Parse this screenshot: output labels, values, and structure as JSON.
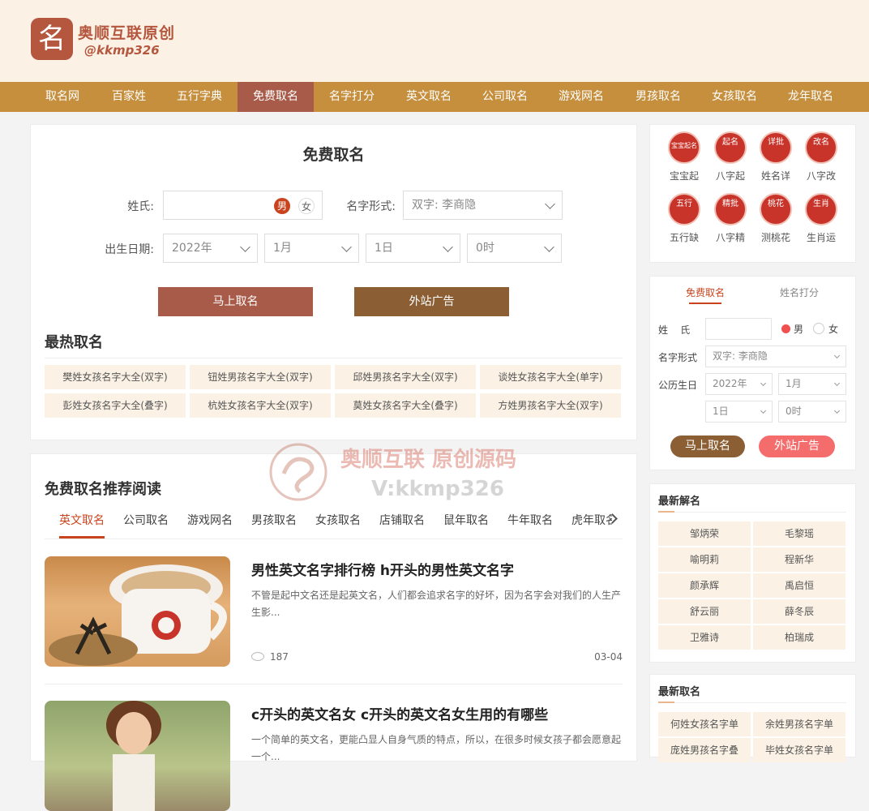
{
  "logo": {
    "mark": "名",
    "line1": "奥顺互联原创",
    "line2": "@kkmp326"
  },
  "nav": [
    "取名网",
    "百家姓",
    "五行字典",
    "免费取名",
    "名字打分",
    "英文取名",
    "公司取名",
    "游戏网名",
    "男孩取名",
    "女孩取名",
    "龙年取名"
  ],
  "nav_active": "免费取名",
  "form": {
    "title": "免费取名",
    "surname_label": "姓氏:",
    "male": "男",
    "female": "女",
    "style_label": "名字形式:",
    "style_value": "双字: 李商隐",
    "birth_label": "出生日期:",
    "year": "2022年",
    "month": "1月",
    "day": "1日",
    "hour": "0时",
    "btn_submit": "马上取名",
    "btn_ad": "外站广告"
  },
  "hot": {
    "title": "最热取名",
    "items": [
      "樊姓女孩名字大全(双字)",
      "钮姓男孩名字大全(双字)",
      "邱姓男孩名字大全(双字)",
      "谈姓女孩名字大全(单字)",
      "彭姓女孩名字大全(叠字)",
      "杭姓女孩名字大全(双字)",
      "莫姓女孩名字大全(叠字)",
      "方姓男孩名字大全(双字)"
    ]
  },
  "reading": {
    "title": "免费取名推荐阅读",
    "tabs": [
      "英文取名",
      "公司取名",
      "游戏网名",
      "男孩取名",
      "女孩取名",
      "店铺取名",
      "鼠年取名",
      "牛年取名",
      "虎年取名"
    ],
    "articles": [
      {
        "title": "男性英文名字排行榜 h开头的男性英文名字",
        "desc": "不管是起中文名还是起英文名，人们都会追求名字的好坏，因为名字会对我们的人生产生影...",
        "views": "187",
        "date": "03-04"
      },
      {
        "title": "c开头的英文名女 c开头的英文名女生用的有哪些",
        "desc": "一个简单的英文名，更能凸显人自身气质的特点，所以，在很多时候女孩子都会愿意起一个..."
      }
    ]
  },
  "watermark": {
    "line1": "奥顺互联 原创源码",
    "line2": "V:kkmp326"
  },
  "side_icons": [
    {
      "top": "宝宝起名",
      "label": "宝宝起"
    },
    {
      "top": "起名",
      "label": "八字起"
    },
    {
      "top": "详批",
      "label": "姓名详"
    },
    {
      "top": "改名",
      "label": "八字改"
    },
    {
      "top": "五行",
      "label": "五行缺"
    },
    {
      "top": "精批",
      "label": "八字精"
    },
    {
      "top": "桃花",
      "label": "测桃花"
    },
    {
      "top": "生肖",
      "label": "生肖运"
    }
  ],
  "side_form": {
    "tab1": "免费取名",
    "tab2": "姓名打分",
    "surname_label": "姓    氏",
    "male": "男",
    "female": "女",
    "style_label": "名字形式",
    "style_value": "双字: 李商隐",
    "birth_label": "公历生日",
    "year": "2022年",
    "month": "1月",
    "day": "1日",
    "hour": "0时",
    "btn_submit": "马上取名",
    "btn_ad": "外站广告"
  },
  "latest_analysis": {
    "title": "最新解名",
    "names": [
      "邹炳荣",
      "毛黎瑶",
      "喻明莉",
      "程新华",
      "颜承辉",
      "禹启恒",
      "舒云丽",
      "薛冬辰",
      "卫雅诗",
      "柏瑞成"
    ]
  },
  "latest_naming": {
    "title": "最新取名",
    "items": [
      "何姓女孩名字单",
      "余姓男孩名字单",
      "庞姓男孩名字叠",
      "毕姓女孩名字单"
    ]
  },
  "colors": {
    "nav": "#c68f3e",
    "nav_active": "#a85b48",
    "header_bg": "#fbf2e5",
    "btn_submit": "#a85b48",
    "btn_ad": "#8b5e34",
    "accent_red": "#c9342a",
    "side_btn_ad": "#f56c6c"
  }
}
